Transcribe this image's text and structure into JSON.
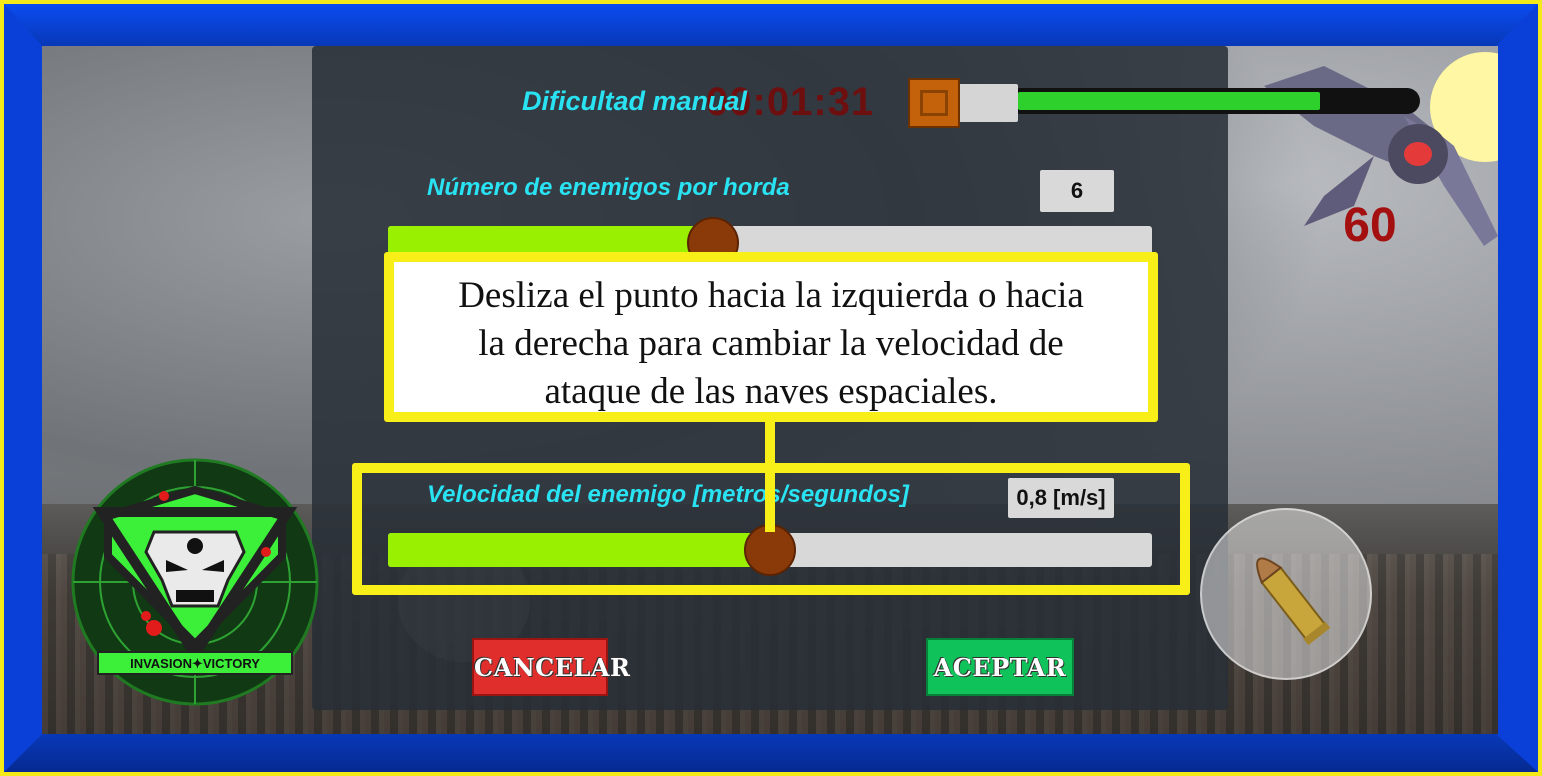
{
  "hud": {
    "timer": "00:01:31",
    "score": "60"
  },
  "settings": {
    "difficulty_label": "Dificultad manual",
    "difficulty_fraction": 0.77,
    "enemies": {
      "label": "Número de enemigos por horda",
      "value": "6",
      "fraction": 0.425
    },
    "speed": {
      "label": "Velocidad del enemigo [metros/segundos]",
      "value": "0,8 [m/s]",
      "fraction": 0.5
    }
  },
  "buttons": {
    "cancel": "CANCELAR",
    "accept": "ACEPTAR"
  },
  "tooltip": {
    "line1": "Desliza el punto hacia la izquierda o hacia",
    "line2": "la derecha para cambiar la velocidad de",
    "line3": "ataque de las naves espaciales."
  },
  "logo": {
    "banner": "INVASION✦VICTORY"
  },
  "colors": {
    "accent_cyan": "#29e3f3",
    "slider_fill": "#99f000",
    "knob": "#8a3a08",
    "highlight": "#f7ef17",
    "cancel": "#df2e2b",
    "accept": "#0fc25a"
  }
}
